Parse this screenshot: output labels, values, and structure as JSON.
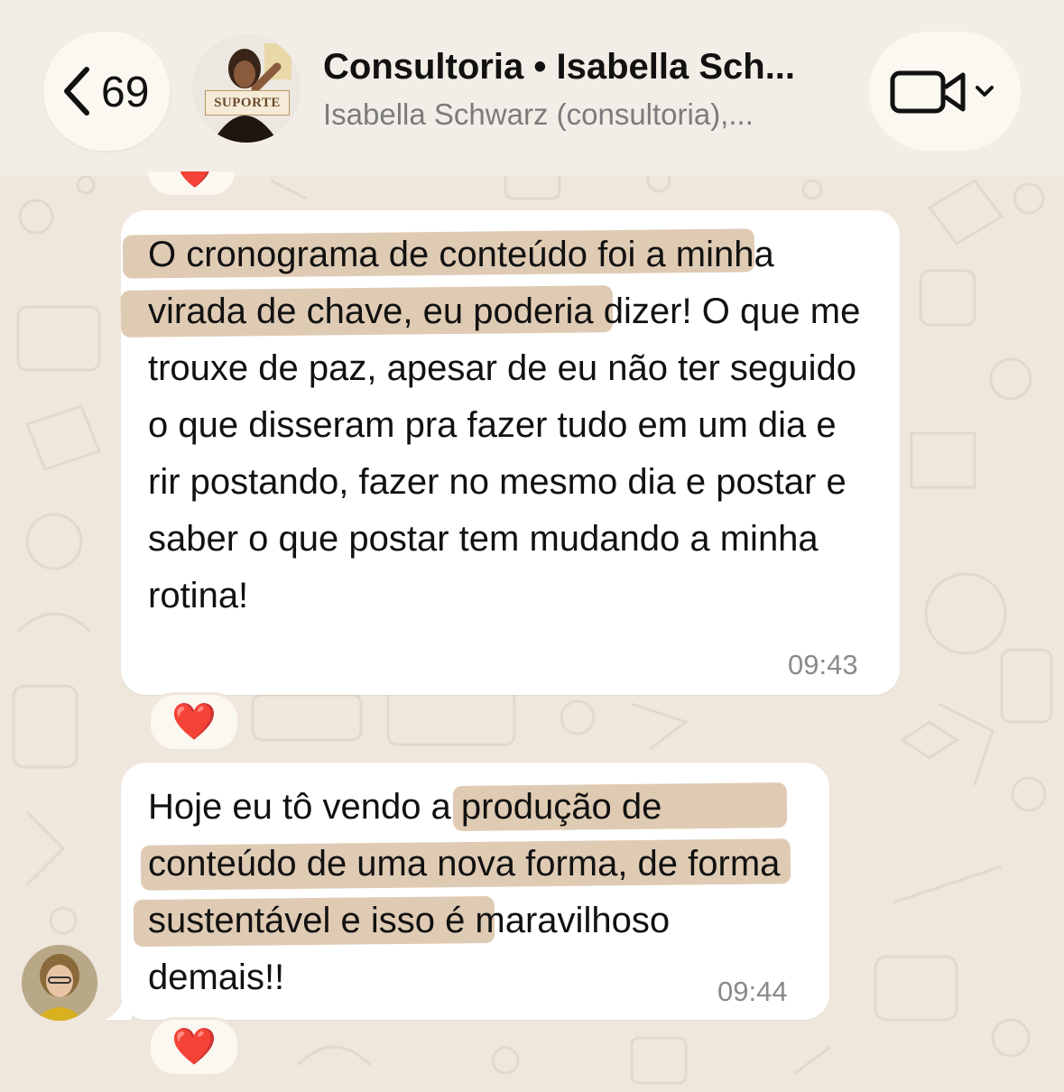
{
  "header": {
    "back_count": "69",
    "group_avatar_tag": "SUPORTE",
    "title": "Consultoria • Isabella Sch...",
    "subtitle": "Isabella Schwarz (consultoria),..."
  },
  "messages": [
    {
      "text": "O cronograma de conteúdo foi a minha virada de chave, eu poderia dizer! O que me trouxe de paz, apesar de eu não ter seguido o que disseram pra fazer tudo em um dia e rir postando, fazer no mesmo dia e postar e saber o que postar tem mudando a minha rotina!",
      "time": "09:43",
      "reaction": "❤️"
    },
    {
      "text": "Hoje eu tô vendo a produção de conteúdo de uma nova forma, de forma sustentável e isso é maravilhoso demais!!",
      "time": "09:44",
      "reaction": "❤️"
    }
  ],
  "previous_reaction": "❤️",
  "colors": {
    "wallpaper": "#efe6dc",
    "bubble": "#ffffff",
    "highlight": "#c4a076",
    "heart": "#e0202a"
  }
}
